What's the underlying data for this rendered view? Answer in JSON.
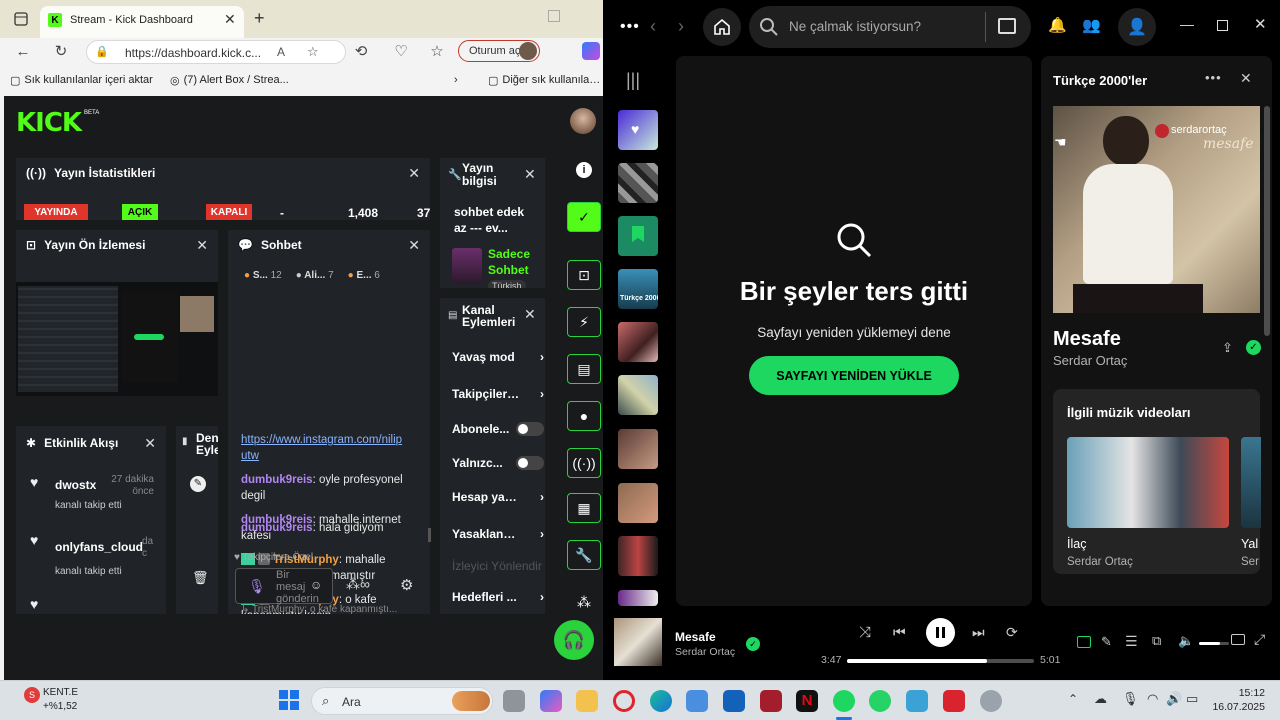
{
  "edge": {
    "tab_title": "Stream - Kick Dashboard",
    "url": "https://dashboard.kick.c...",
    "login_label": "Oturum aç",
    "bookmarks": [
      "Sık kullanılanlar içeri aktar",
      "(7) Alert Box / Strea...",
      "Diğer sık kullanılanlar"
    ]
  },
  "kick": {
    "logo": "KICK",
    "beta": "BETA",
    "stats": {
      "title": "Yayın İstatistikleri",
      "cells": [
        "YAYINDA",
        "AÇIK",
        "KAPALI",
        "-",
        "1,408",
        "37"
      ]
    },
    "info": {
      "title": "Yayın bilgisi",
      "text": "sohbet edek az --- ev...",
      "cat1": "Sadece",
      "cat2": "Sohbet",
      "tag": "Türkish"
    },
    "preview": {
      "title": "Yayın Ön İzlemesi"
    },
    "chat": {
      "title": "Sohbet",
      "top": [
        {
          "n": "S...",
          "c": "12"
        },
        {
          "n": "Ali...",
          "c": "7"
        },
        {
          "n": "E...",
          "c": "6"
        }
      ],
      "messages": [
        {
          "user": "",
          "text": "https://www.instagram.com/nilip utw",
          "link": true
        },
        {
          "user": "dumbuk9reis",
          "text": ": oyle profesyonel degil"
        },
        {
          "user": "dumbuk9reis",
          "text": ": mahalle internet kafesi"
        },
        {
          "user": "TristMurphy",
          "text": ": mahalle internet kafesi kalmamıştır",
          "badges": true
        },
        {
          "user": "TristMurphy",
          "text": ": o kafe kapanmıştır kesin",
          "badges": true
        }
      ],
      "reply": "TristMurphy: o kafe kapanmıştı...",
      "last_user": "dumbuk9reis",
      "last_text": ": hala gidiyom",
      "followers_only": "Takipçilere Özel",
      "input_placeholder": "Bir mesaj gönderin"
    },
    "actions": {
      "title": "Kanal Eylemleri",
      "rows": [
        "Yavaş mod",
        "Takipçilere Ö",
        "Abonele...",
        "Yalnızc...",
        "Hesap yaşı k",
        "Yasaklanmış",
        "İzleyici Yönlendir",
        "Hedefleri ..."
      ]
    },
    "activity": {
      "title": "Etkinlik Akışı",
      "items": [
        {
          "name": "dwostx",
          "time": "27 dakika önce",
          "action": "kanalı takip etti"
        },
        {
          "name": "onlyfans_cloud",
          "time": "da c",
          "action": "kanalı takip etti"
        }
      ]
    },
    "deneme": {
      "title": "Dene Eyle"
    }
  },
  "spotify": {
    "search_placeholder": "Ne çalmak istiyorsun?",
    "error_title": "Bir şeyler ters gitti",
    "error_sub": "Sayfayı yeniden yüklemeyi dene",
    "reload": "SAYFAYI YENİDEN YÜKLE",
    "playlist": "Türkçe 2000'ler",
    "art_brand": "serdarortaç",
    "art_title": "mesafe",
    "song": "Mesafe",
    "artist": "Serdar Ortaç",
    "videos_title": "İlgili müzik videoları",
    "video": {
      "title": "İlaç",
      "artist": "Serdar Ortaç"
    },
    "video2": {
      "title": "Yal",
      "artist": "Ser"
    },
    "now_title": "Mesafe",
    "now_artist": "Serdar Ortaç",
    "elapsed": "3:47",
    "total": "5:01",
    "progress": 0.75,
    "volume": 0.7,
    "tile_label": "Türkçe 2000'ler"
  },
  "taskbar": {
    "stock": "KENT.E",
    "change": "+%1,52",
    "search": "Ara",
    "time": "15:12",
    "date": "16.07.2025"
  },
  "colors": {
    "kick_green": "#53fc18",
    "spotify_green": "#1ed760"
  }
}
